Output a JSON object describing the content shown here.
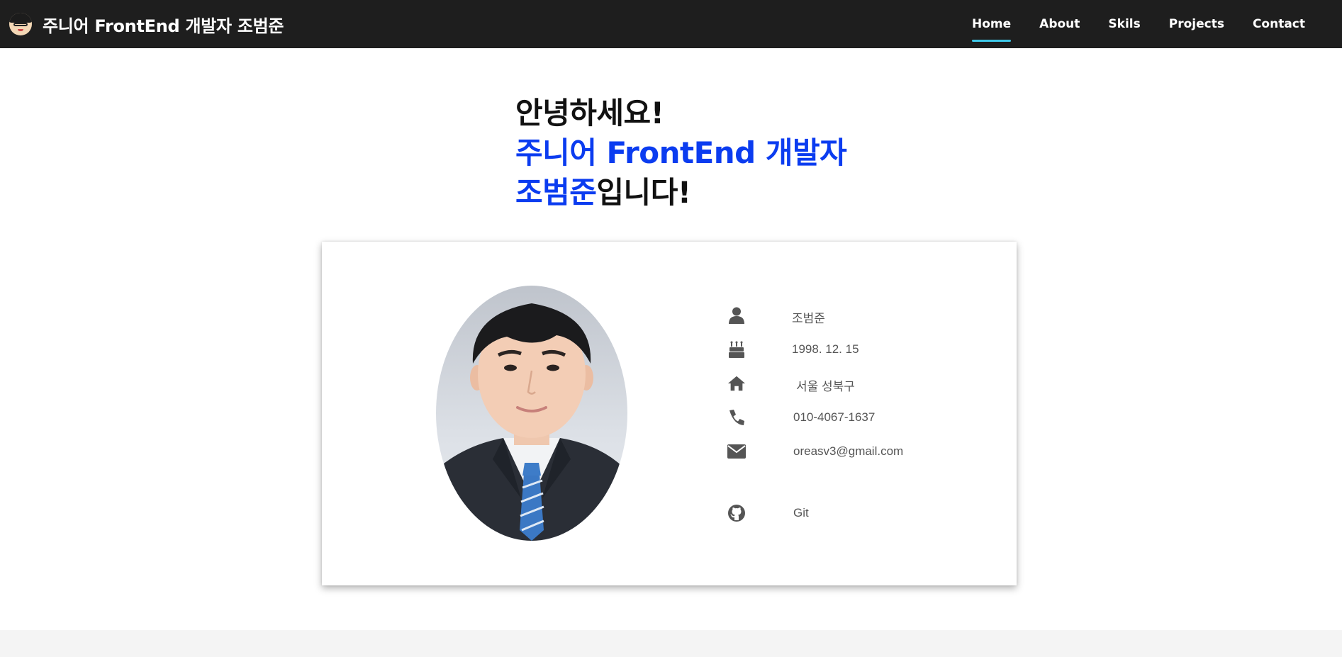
{
  "header": {
    "title": "주니어 FrontEnd 개발자 조범준",
    "nav": [
      {
        "label": "Home",
        "active": true
      },
      {
        "label": "About",
        "active": false
      },
      {
        "label": "Skils",
        "active": false
      },
      {
        "label": "Projects",
        "active": false
      },
      {
        "label": "Contact",
        "active": false
      }
    ]
  },
  "hero": {
    "line1": "안녕하세요!",
    "line2": "주니어 FrontEnd 개발자",
    "line3_name": "조범준",
    "line3_suffix": "입니다!"
  },
  "profile": {
    "name": "조범준",
    "birth": "1998. 12. 15",
    "address": "서울 성북구",
    "phone": "010-4067-1637",
    "email": "oreasv3@gmail.com",
    "git": "Git"
  },
  "icons": {
    "name": "user-icon",
    "birth": "birthday-cake-icon",
    "address": "home-icon",
    "phone": "phone-icon",
    "email": "envelope-icon",
    "git": "github-icon"
  },
  "colors": {
    "header_bg": "#1e1e1e",
    "accent_blue": "#0b3cf0",
    "nav_underline": "#3ec7e8",
    "icon_gray": "#555555"
  }
}
